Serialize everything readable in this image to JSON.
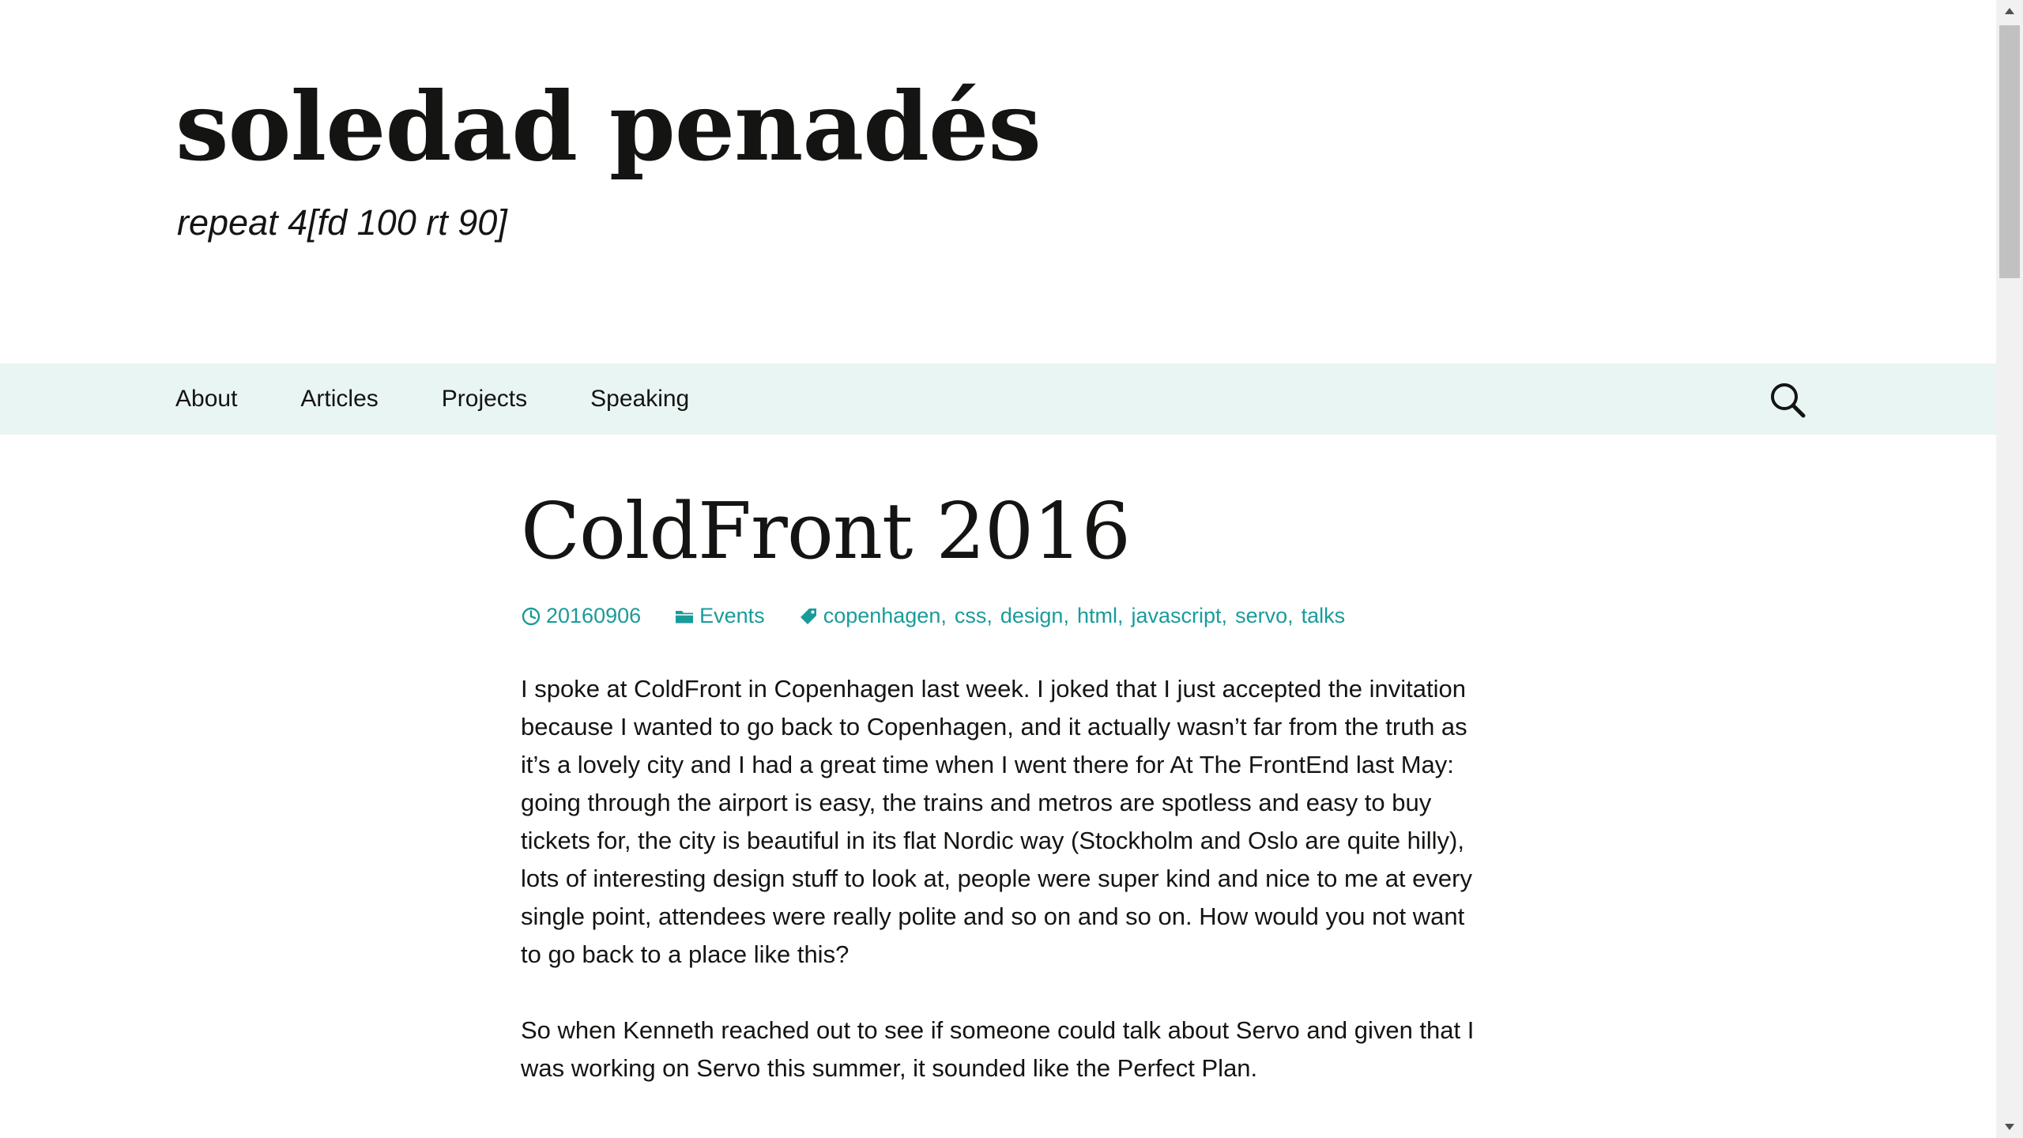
{
  "site": {
    "title": "soledad penadés",
    "tagline": "repeat 4[fd 100 rt 90]"
  },
  "nav": {
    "items": [
      {
        "label": "About"
      },
      {
        "label": "Articles"
      },
      {
        "label": "Projects"
      },
      {
        "label": "Speaking"
      }
    ],
    "search_icon": "search-icon"
  },
  "post": {
    "title": "ColdFront 2016",
    "date": "20160906",
    "category": "Events",
    "tags": [
      "copenhagen",
      "css",
      "design",
      "html",
      "javascript",
      "servo",
      "talks"
    ],
    "paragraphs": [
      "I spoke at ColdFront in Copenhagen last week. I joked that I just accepted the invitation because I wanted to go back to Copenhagen, and it actually wasn’t far from the truth as it’s a lovely city and I had a great time when I went there for At The FrontEnd last May: going through the airport is easy, the trains and metros are spotless and easy to buy tickets for, the city is beautiful in its flat Nordic way (Stockholm and Oslo are quite hilly), lots of interesting design stuff to look at, people were super kind and nice to me at every single point, attendees were really polite and so on and so on. How would you not want to go back to a place like this?",
      "So when Kenneth reached out to see if someone could talk about Servo and given that I was working on Servo this summer, it sounded like the Perfect Plan."
    ]
  },
  "colors": {
    "nav_background": "#e8f5f3",
    "link": "#1a9b9b",
    "text": "#141412"
  }
}
